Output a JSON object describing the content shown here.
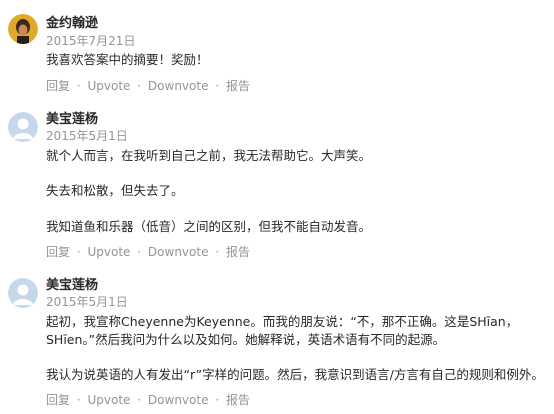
{
  "comments": [
    {
      "author": "金约翰逊",
      "date": "2015年7月21日",
      "paragraphs": [
        "我喜欢答案中的摘要！奖励！"
      ],
      "actions": [
        "回复",
        "Upvote",
        "Downvote",
        "报告"
      ]
    },
    {
      "author": "美宝莲杨",
      "date": "2015年5月1日",
      "paragraphs": [
        "就个人而言，在我听到自己之前，我无法帮助它。大声笑。",
        "失去和松散，但失去了。",
        "我知道鱼和乐器（低音）之间的区别，但我不能自动发音。"
      ],
      "actions": [
        "回复",
        "Upvote",
        "Downvote",
        "报告"
      ]
    },
    {
      "author": "美宝莲杨",
      "date": "2015年5月1日",
      "paragraphs": [
        "起初，我宣称Cheyenne为Keyenne。而我的朋友说：“不，那不正确。这是SHīan，",
        "SHīen。”然后我问为什么以及如何。她解释说，英语术语有不同的起源。",
        "我认为说英语的人有发出“r”字样的问题。然后，我意识到语言/方言有自己的规则和例外。"
      ],
      "actions": [
        "回复",
        "Upvote",
        "Downvote",
        "报告"
      ]
    }
  ],
  "action_separator": "·",
  "colors": {
    "muted": "#939598",
    "text": "#282829",
    "avatar_bg": "#c5d7ea"
  }
}
